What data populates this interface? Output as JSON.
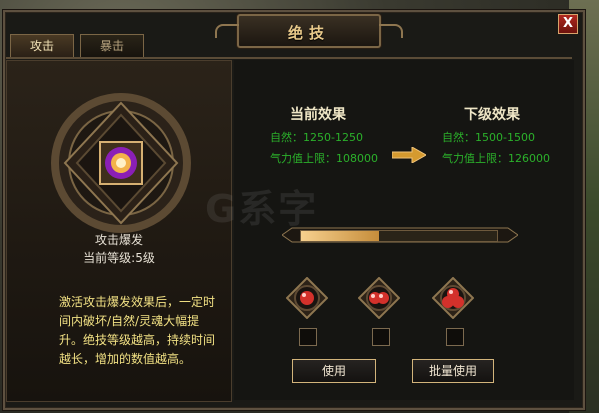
{
  "window": {
    "title": "绝技",
    "close_label": "X"
  },
  "tabs": [
    {
      "label": "攻击",
      "active": true
    },
    {
      "label": "暴击",
      "active": false
    }
  ],
  "skill": {
    "name": "攻击爆发",
    "level": "当前等级:5级",
    "description": "激活攻击爆发效果后，一定时间内破坏/自然/灵魂大幅提升。绝技等级越高，持续时间越长，增加的数值越高。"
  },
  "current": {
    "title": "当前效果",
    "line1": "自然：1250-1250",
    "line2": "气力值上限：108000"
  },
  "next": {
    "title": "下级效果",
    "line1": "自然：1500-1500",
    "line2": "气力值上限：126000"
  },
  "progress": {
    "fraction": 0.4
  },
  "items": [
    {
      "icon": "red-orb-1"
    },
    {
      "icon": "red-orb-2"
    },
    {
      "icon": "red-orb-3"
    }
  ],
  "buttons": {
    "use": "使用",
    "batch_use": "批量使用"
  },
  "watermark": "G系字",
  "colors": {
    "green_text": "#2bb12b",
    "yellow_text": "#f2e184",
    "bar_fill": "#f0c37a"
  }
}
